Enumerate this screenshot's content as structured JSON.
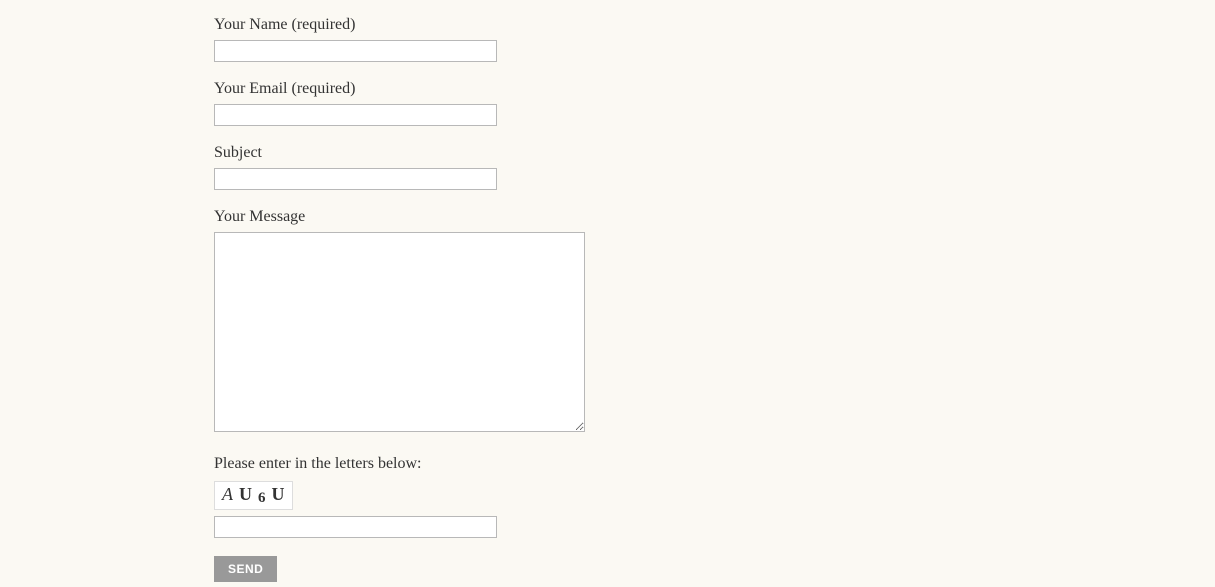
{
  "form": {
    "name": {
      "label": "Your Name (required)",
      "value": ""
    },
    "email": {
      "label": "Your Email (required)",
      "value": ""
    },
    "subject": {
      "label": "Subject",
      "value": ""
    },
    "message": {
      "label": "Your Message",
      "value": ""
    },
    "captcha": {
      "label": "Please enter in the letters below:",
      "chars": [
        "A",
        "U",
        "6",
        "U"
      ],
      "value": ""
    },
    "submit": {
      "label": "SEND"
    }
  }
}
